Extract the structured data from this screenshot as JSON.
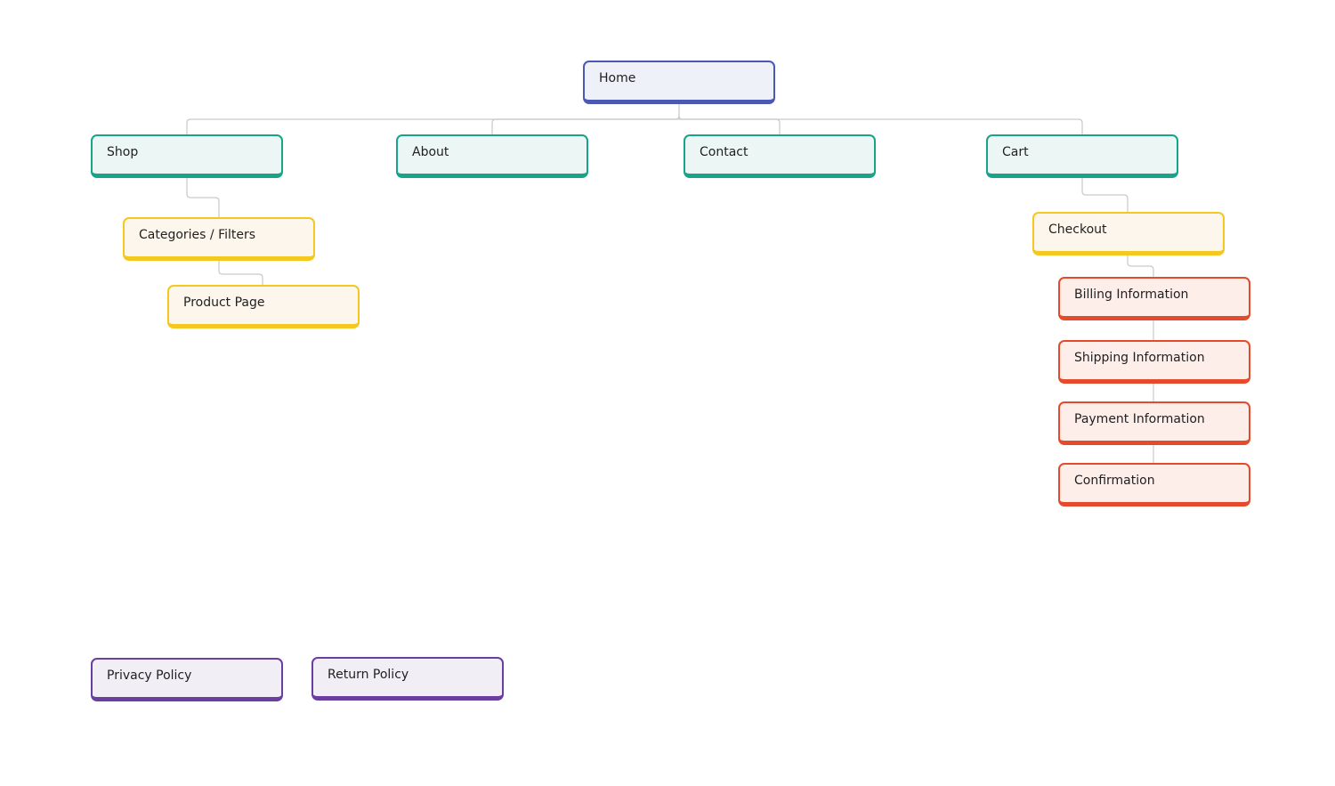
{
  "diagram": {
    "type": "sitemap",
    "nodes": {
      "home": {
        "label": "Home",
        "color": "#4b59b5"
      },
      "shop": {
        "label": "Shop",
        "color": "#17a488"
      },
      "about": {
        "label": "About",
        "color": "#17a488"
      },
      "contact": {
        "label": "Contact",
        "color": "#17a488"
      },
      "cart": {
        "label": "Cart",
        "color": "#17a488"
      },
      "categories": {
        "label": "Categories / Filters",
        "color": "#f4c81f"
      },
      "product": {
        "label": "Product Page",
        "color": "#f4c81f"
      },
      "checkout": {
        "label": "Checkout",
        "color": "#f4c81f"
      },
      "billing": {
        "label": "Billing Information",
        "color": "#e54a2c"
      },
      "shipping": {
        "label": "Shipping Information",
        "color": "#e54a2c"
      },
      "payment": {
        "label": "Payment Information",
        "color": "#e54a2c"
      },
      "confirmation": {
        "label": "Confirmation",
        "color": "#e54a2c"
      },
      "privacy": {
        "label": "Privacy Policy",
        "color": "#6a3fa0"
      },
      "returns": {
        "label": "Return Policy",
        "color": "#6a3fa0"
      }
    },
    "edges": [
      [
        "home",
        "shop"
      ],
      [
        "home",
        "about"
      ],
      [
        "home",
        "contact"
      ],
      [
        "home",
        "cart"
      ],
      [
        "shop",
        "categories"
      ],
      [
        "categories",
        "product"
      ],
      [
        "cart",
        "checkout"
      ],
      [
        "checkout",
        "billing"
      ],
      [
        "billing",
        "shipping"
      ],
      [
        "shipping",
        "payment"
      ],
      [
        "payment",
        "confirmation"
      ]
    ]
  }
}
